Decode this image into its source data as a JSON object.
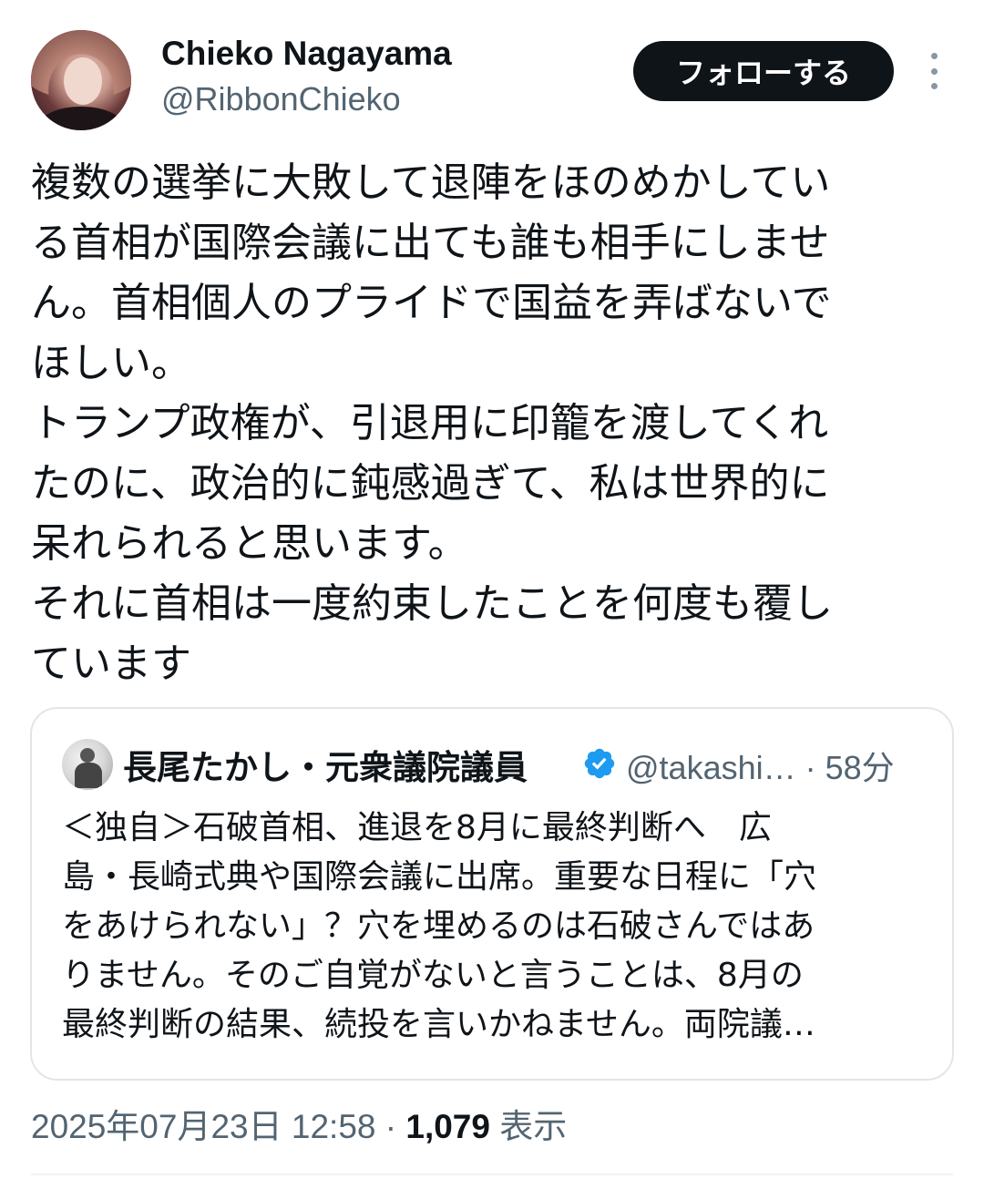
{
  "author": {
    "display_name": "Chieko Nagayama",
    "handle": "@RibbonChieko"
  },
  "follow_button": {
    "label": "フォローする"
  },
  "more_button": {
    "icon": "more-vertical-icon"
  },
  "tweet": {
    "lines": [
      "複数の選挙に大敗して退陣をほのめかしてい",
      "る首相が国際会議に出ても誰も相手にしませ",
      "ん。首相個人のプライドで国益を弄ばないで",
      "ほしい。",
      "トランプ政権が、引退用に印籠を渡してくれ",
      "たのに、政治的に鈍感過ぎて、私は世界的に",
      "呆れられると思います。",
      "それに首相は一度約束したことを何度も覆し",
      "ています"
    ]
  },
  "quote": {
    "display_name": "長尾たかし・元衆議院議員",
    "verified": true,
    "verified_color": "#1d9bf0",
    "handle_time": "@takashi… · 58分",
    "lines": [
      "＜独自＞石破首相、進退を8月に最終判断へ　広",
      "島・長崎式典や国際会議に出席。重要な日程に「穴",
      "をあけられない」？穴を埋めるのは石破さんではあ",
      "りません。そのご自覚がないと言うことは、8月の",
      "最終判断の結果、続投を言いかねません。両院議…"
    ]
  },
  "meta": {
    "timestamp": "2025年07月23日 12:58 · ",
    "views_count": "1,079",
    "views_label": " 表示"
  },
  "colors": {
    "text": "#0f1419",
    "secondary": "#536471",
    "follow_bg": "#0f1419",
    "border": "#e1e6ea"
  }
}
